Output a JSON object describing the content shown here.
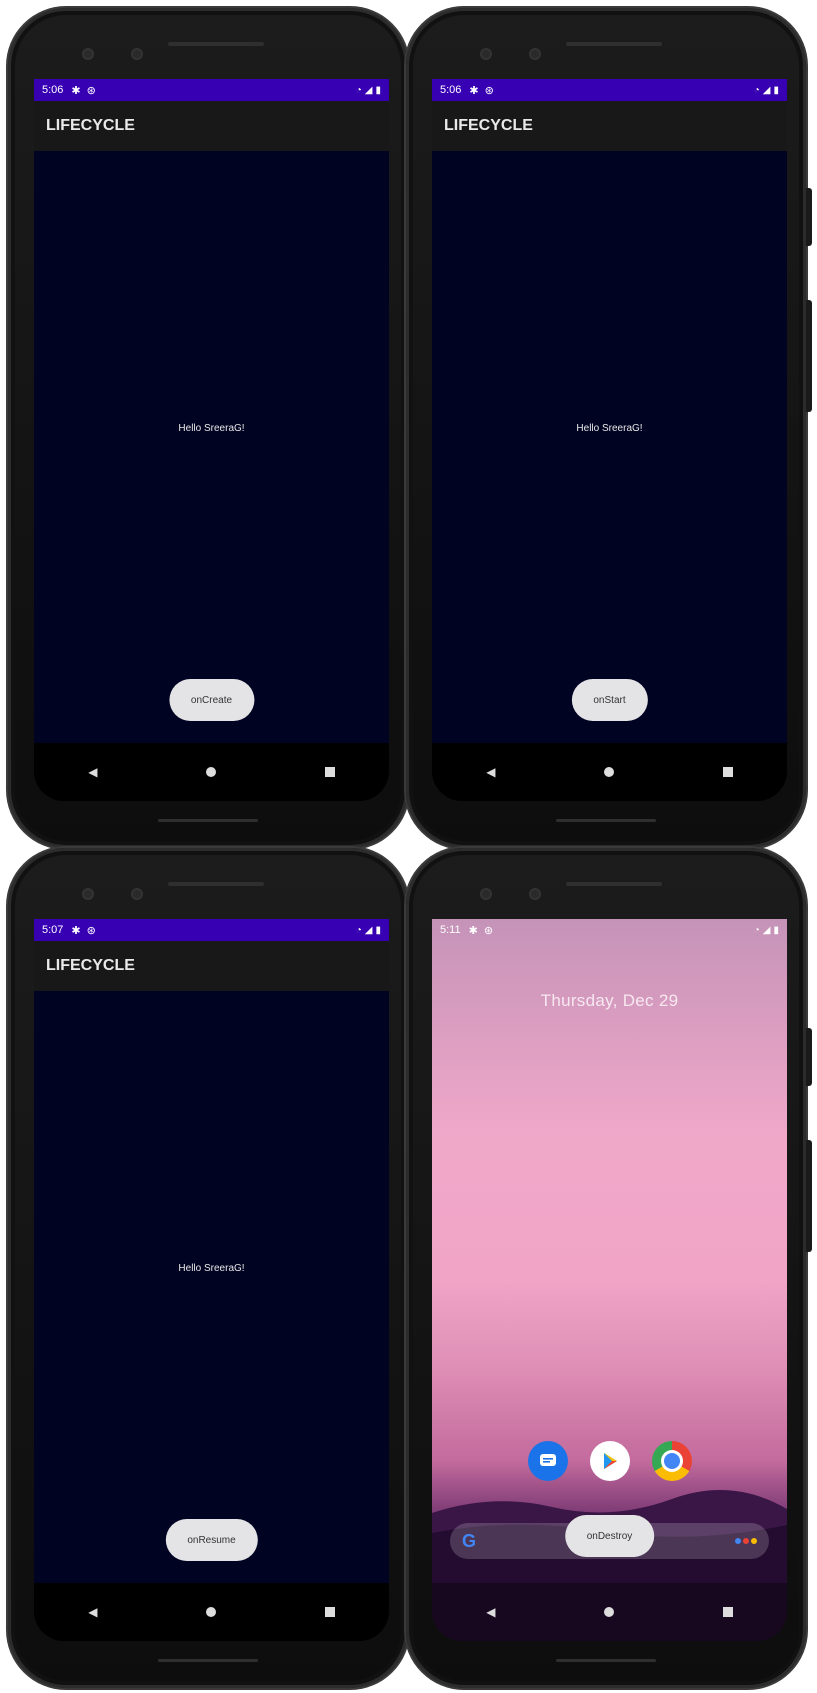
{
  "phones": [
    {
      "time": "5:06",
      "title": "LIFECYCLE",
      "hello": "Hello SreeraG!",
      "button": "onCreate"
    },
    {
      "time": "5:06",
      "title": "LIFECYCLE",
      "hello": "Hello SreeraG!",
      "button": "onStart"
    },
    {
      "time": "5:07",
      "title": "LIFECYCLE",
      "hello": "Hello SreeraG!",
      "button": "onResume"
    },
    {
      "time": "5:11",
      "date": "Thursday, Dec 29",
      "button": "onDestroy"
    }
  ],
  "colors": {
    "status_bar": "#3700b3",
    "app_bar": "#181818",
    "screen_bg": "#010322",
    "button_bg": "#e4e4e6"
  },
  "icons": [
    "gear-icon",
    "do-not-disturb-icon",
    "wifi-icon",
    "signal-icon",
    "battery-icon",
    "back-icon",
    "home-icon",
    "recents-icon",
    "messages-icon",
    "play-store-icon",
    "chrome-icon",
    "google-icon",
    "assistant-icon"
  ]
}
